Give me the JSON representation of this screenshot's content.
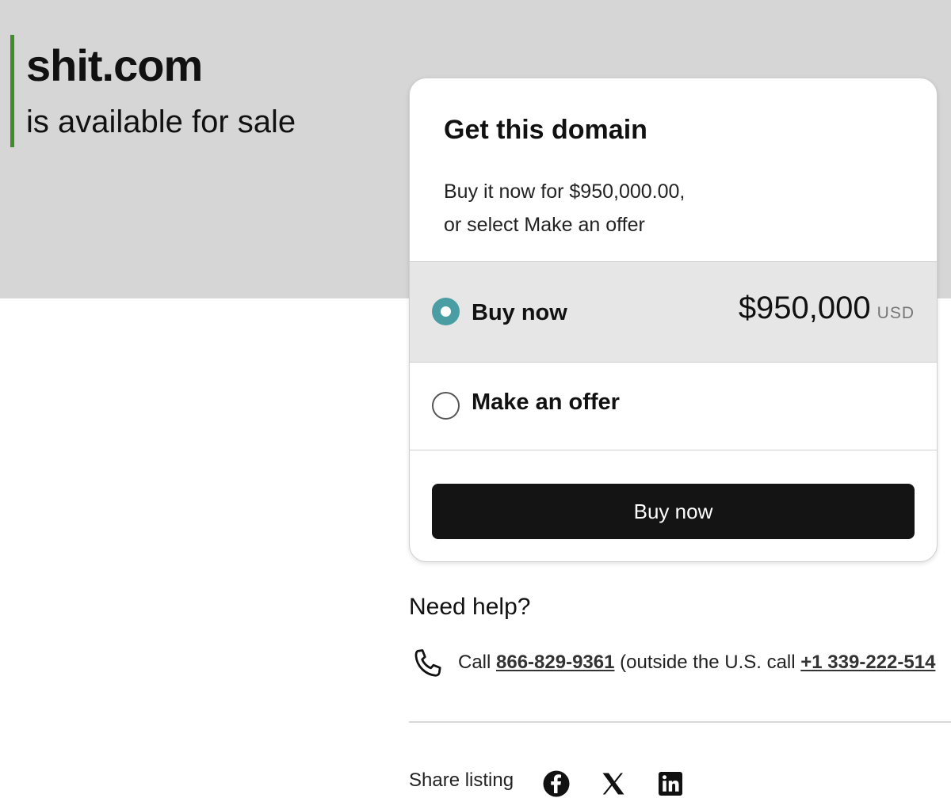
{
  "hero": {
    "domain": "shit.com",
    "subtitle": "is available for sale",
    "accent_color": "#3e8e2a",
    "background": "#d6d6d6"
  },
  "card": {
    "title": "Get this domain",
    "description_line1": "Buy it now for $950,000.00,",
    "description_line2": "or select Make an offer",
    "options": [
      {
        "label": "Buy now",
        "selected": true,
        "price": "$950,000",
        "currency": "USD"
      },
      {
        "label": "Make an offer",
        "selected": false
      }
    ],
    "cta_label": "Buy now",
    "radio_color": "#4a9ea3"
  },
  "help": {
    "title": "Need help?",
    "call_prefix": "Call",
    "phone": "866-829-9361",
    "outside_text": "(outside the U.S. call",
    "intl_phone": "+1 339-222-514"
  },
  "share": {
    "label": "Share listing",
    "icons": [
      "facebook-icon",
      "x-icon",
      "linkedin-icon"
    ]
  }
}
